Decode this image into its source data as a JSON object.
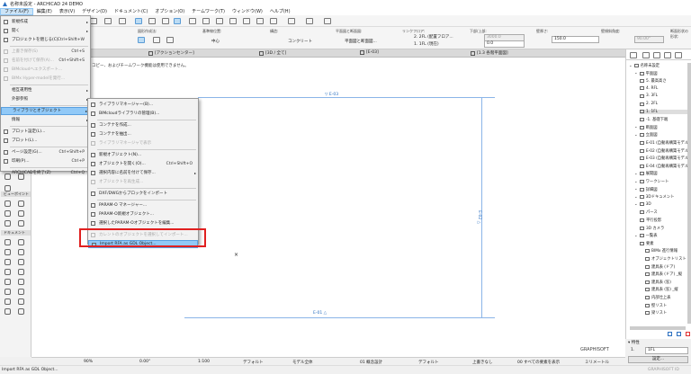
{
  "window": {
    "title": "名称未設定 - ARCHICAD 24 DEMO"
  },
  "menubar": [
    "ファイル(F)",
    "編集(E)",
    "表示(V)",
    "デザイン(D)",
    "ドキュメント(C)",
    "オプション(O)",
    "チームワーク(T)",
    "ウィンドウ(W)",
    "ヘルプ(H)"
  ],
  "infobox": {
    "geometry_label": "図形作成法:",
    "anchor_label": "基準線位置:",
    "anchor_value": "中心",
    "structure_label": "構造:",
    "material_value": "コンクリート",
    "floorplan_label": "平面図と断面図:",
    "floorplan_value": "平面図と断面図...",
    "story_label": "リンクフロア:",
    "story_top": "2. 2FL (配置フロア...",
    "story_bottom": "1. 1FL (現在)",
    "height_label": "下部/上部:",
    "height_top": "3000.0",
    "height_bottom": "0.0",
    "thickness_label": "壁厚さ:",
    "thickness_value": "150.0",
    "slant_label": "壁傾斜角度:",
    "slant_value": "90.00°",
    "profile_label": "断面形状の形状:"
  },
  "tabs": [
    "[アクションセンター]",
    "[3D / 全て]",
    "[E-03]",
    "[1.3 各階平面図]"
  ],
  "notice": "コピー、およびチームワーク機能は使用できません。",
  "drawing": {
    "markers": [
      "E-03",
      "E-02",
      "E-01"
    ]
  },
  "toolbox": {
    "sections": [
      "ビューポイント",
      "ドキュメント"
    ]
  },
  "file_menu": [
    {
      "label": "新規作成",
      "arrow": true
    },
    {
      "label": "開く",
      "arrow": true
    },
    {
      "label": "プロジェクトを閉じる(C)",
      "shortcut": "Ctrl+Shift+W"
    },
    {
      "label": "上書き保存(S)",
      "shortcut": "Ctrl+S",
      "disabled": true
    },
    {
      "label": "名前を付けて保存(A)...",
      "shortcut": "Ctrl+Shift+S",
      "disabled": true
    },
    {
      "label": "BIMcloudへエクスポート...",
      "disabled": true
    },
    {
      "label": "BIMx Hyper-modelを発行...",
      "disabled": true
    },
    {
      "label": "相互運用性",
      "arrow": true
    },
    {
      "label": "外部参照",
      "arrow": true
    },
    {
      "label": "ライブラリとオブジェクト",
      "arrow": true,
      "highlighted": true
    },
    {
      "label": "情報",
      "arrow": true
    },
    {
      "label": "プロット設定(L)..."
    },
    {
      "label": "プロット(L)..."
    },
    {
      "label": "ページ設定(G)...",
      "shortcut": "Ctrl+Shift+P"
    },
    {
      "label": "印刷(P)...",
      "shortcut": "Ctrl+P"
    },
    {
      "label": "ARCHICADを終了(Z)",
      "shortcut": "Ctrl+Q"
    }
  ],
  "submenu": [
    {
      "label": "ライブラリマネージャー(B)..."
    },
    {
      "label": "BIMcloudライブラリの管理(B)..."
    },
    {
      "label": "コンテナを作成..."
    },
    {
      "label": "コンテナを抽出..."
    },
    {
      "label": "ライブラリマネージャで表示",
      "disabled": true
    },
    {
      "label": "新規オブジェクト(N)..."
    },
    {
      "label": "オブジェクトを開く(O)...",
      "shortcut": "Ctrl+Shift+O"
    },
    {
      "label": "選択内容に名前を付けて保存...",
      "arrow": true
    },
    {
      "label": "オブジェクトを再生成...",
      "disabled": true
    },
    {
      "label": "DXF/DWGからブロックをインポート"
    },
    {
      "label": "PARAM-O マネージャー..."
    },
    {
      "label": "PARAM-O新規オブジェクト..."
    },
    {
      "label": "選択したPARAM-Oオブジェクトを編集..."
    },
    {
      "label": "カレントのオブジェクトを選択してインポート...",
      "disabled": true
    },
    {
      "label": "Import RFA as GDL Object...",
      "highlighted": true
    }
  ],
  "navigator": {
    "items": [
      {
        "label": "名称未設定",
        "level": 0
      },
      {
        "label": "平面図",
        "level": 1
      },
      {
        "label": "5. 最高高さ",
        "level": 2
      },
      {
        "label": "4. RFL",
        "level": 2
      },
      {
        "label": "3. 3FL",
        "level": 2
      },
      {
        "label": "2. 2FL",
        "level": 2
      },
      {
        "label": "1. 1FL",
        "level": 2,
        "selected": true
      },
      {
        "label": "-1. 基礎下端",
        "level": 2
      },
      {
        "label": "断面図",
        "level": 1
      },
      {
        "label": "立面図",
        "level": 1
      },
      {
        "label": "E-01 (自動再構築モデル)",
        "level": 2
      },
      {
        "label": "E-02 (自動再構築モデル)",
        "level": 2
      },
      {
        "label": "E-03 (自動再構築モデル)",
        "level": 2
      },
      {
        "label": "E-04 (自動再構築モデル)",
        "level": 2
      },
      {
        "label": "展開図",
        "level": 1
      },
      {
        "label": "ワークシート",
        "level": 1
      },
      {
        "label": "詳細図",
        "level": 1
      },
      {
        "label": "3Dドキュメント",
        "level": 1
      },
      {
        "label": "3D",
        "level": 1
      },
      {
        "label": "パース",
        "level": 2
      },
      {
        "label": "平行投影",
        "level": 2
      },
      {
        "label": "3D カメラ",
        "level": 2
      },
      {
        "label": "一覧表",
        "level": 1
      },
      {
        "label": "要素",
        "level": 2
      },
      {
        "label": "BIMx 進行情報",
        "level": 3
      },
      {
        "label": "オブジェクトリスト",
        "level": 3
      },
      {
        "label": "建具表 (ドア)",
        "level": 3
      },
      {
        "label": "建具表 (ドア) _縦",
        "level": 3
      },
      {
        "label": "建具表 (窓)",
        "level": 3
      },
      {
        "label": "建具表 (窓) _縦",
        "level": 3
      },
      {
        "label": "内部仕上表",
        "level": 3
      },
      {
        "label": "壁リスト",
        "level": 3
      },
      {
        "label": "梁リスト",
        "level": 3
      }
    ],
    "props_label": "特性",
    "story_id": "1.",
    "story_name": "1FL",
    "settings": "設定...",
    "brand": "GRAPHISOFT ID"
  },
  "bottombar": {
    "zoom": "90%",
    "angle": "0.00°",
    "scale": "1:100",
    "layer": "デフォルト",
    "model": "モデル全体",
    "pen": "01 概念設計",
    "override": "デフォルト",
    "renovation": "上書きなし",
    "filter": "00 すべての要素を表示",
    "unit": "ミリメートル"
  },
  "brand": "GRAPHISOFT",
  "status": "Import RFA as GDL Object...",
  "colors": {
    "highlight": "#91c9f7",
    "callout": "#e02020",
    "drawing_line": "#8ab4e8"
  }
}
